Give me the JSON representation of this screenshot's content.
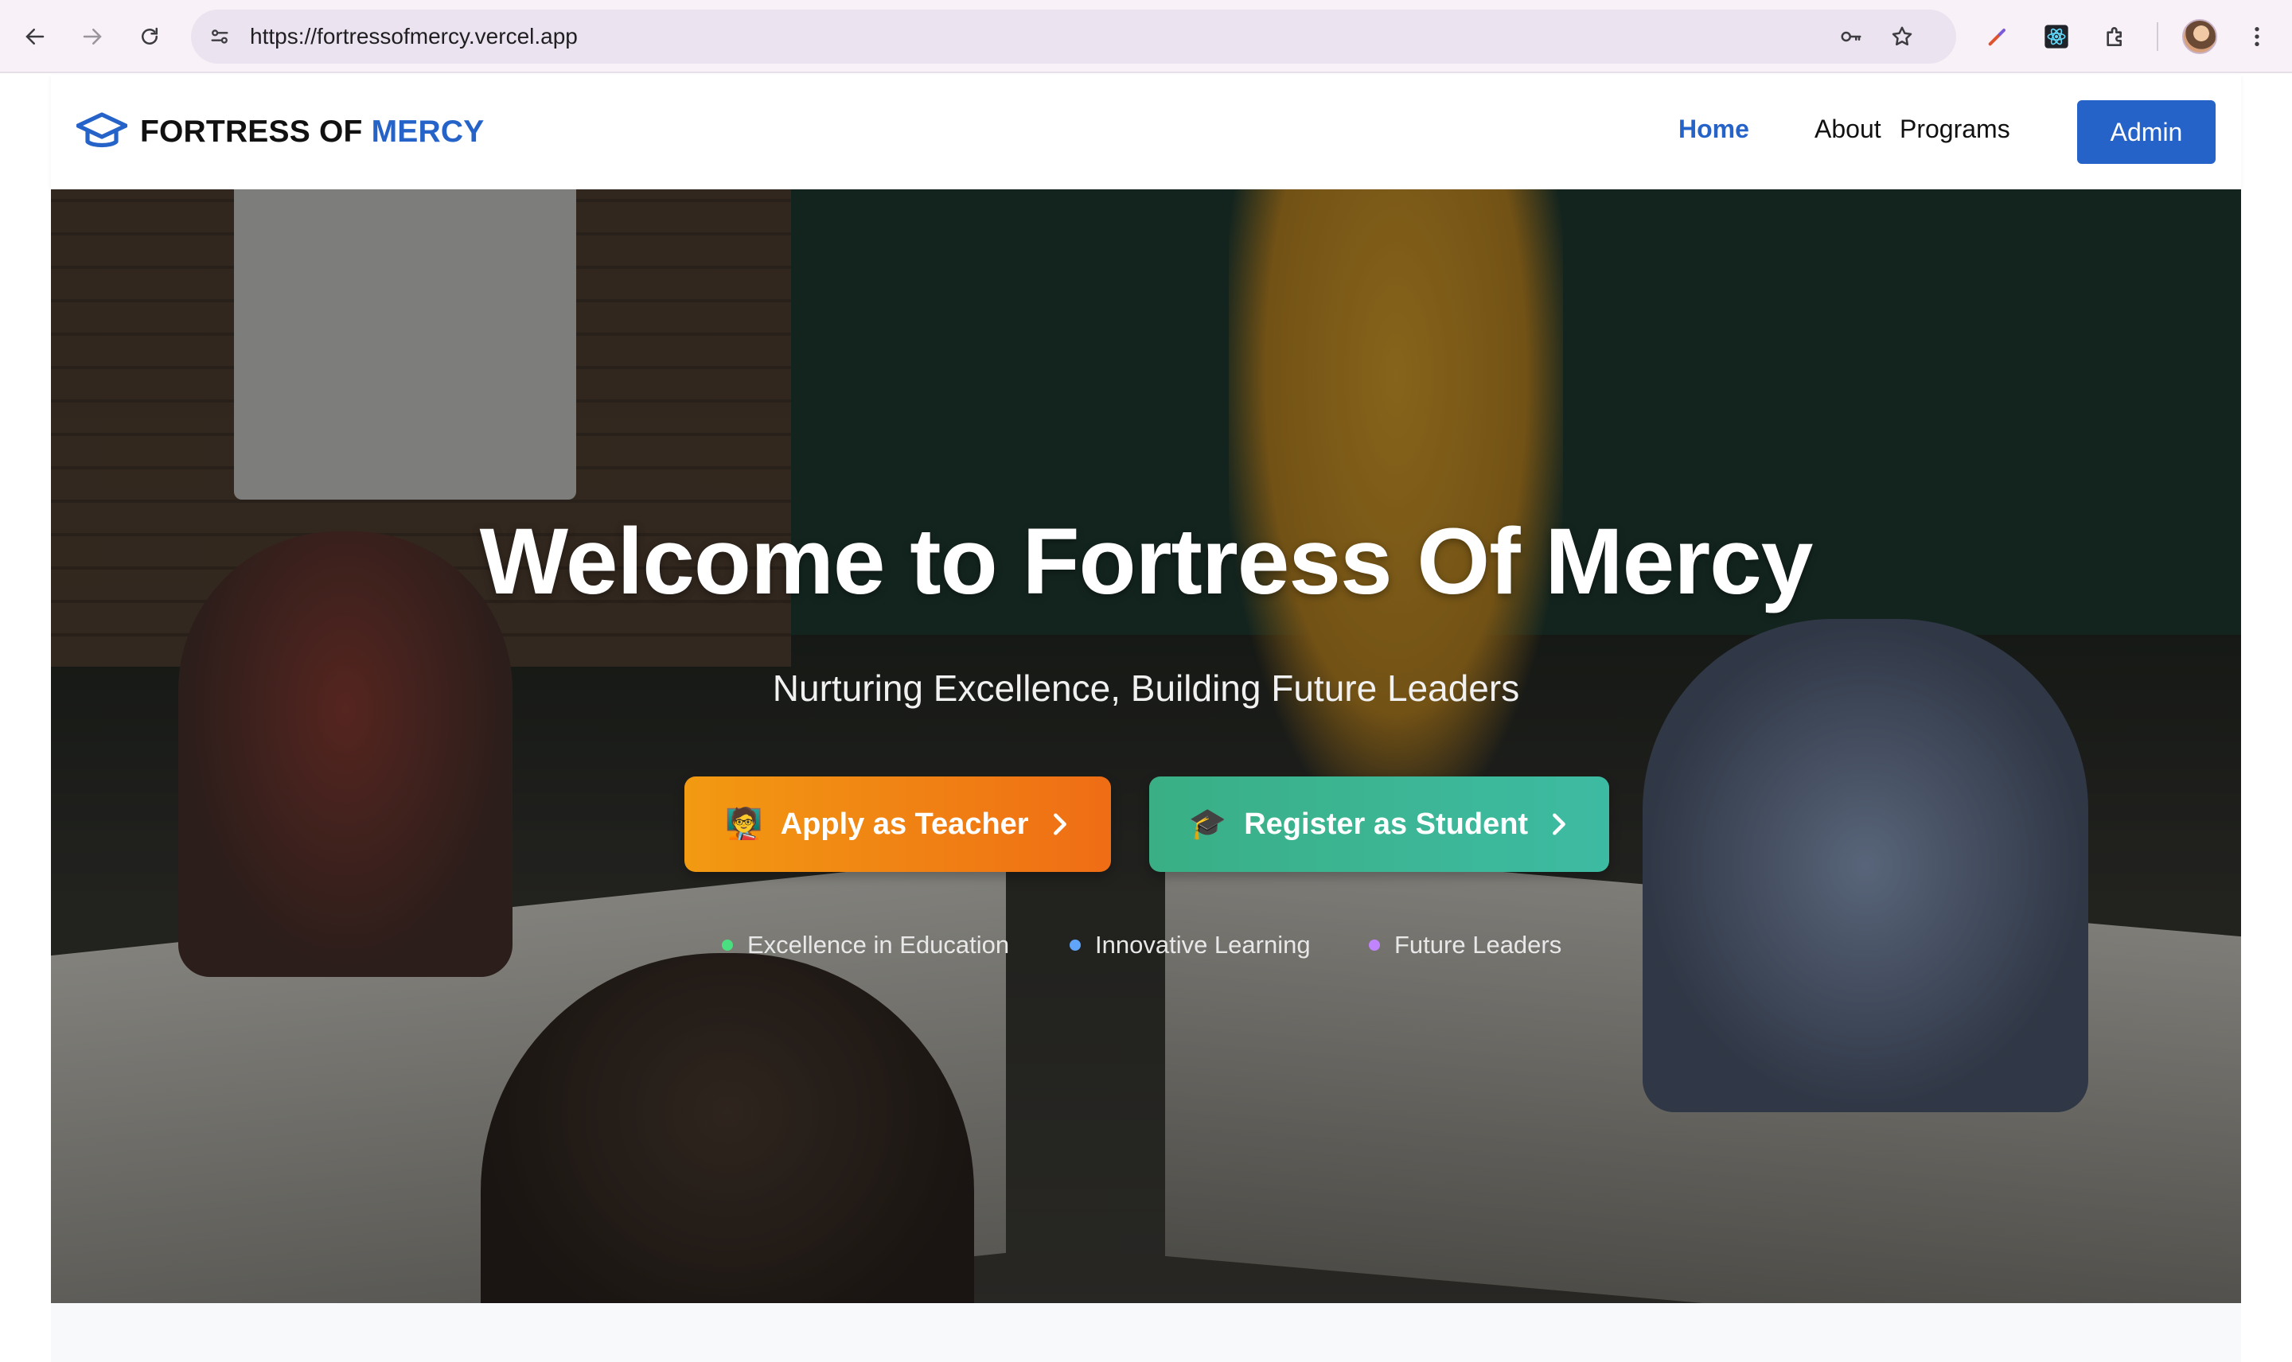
{
  "browser": {
    "url": "https://fortressofmercy.vercel.app",
    "icons": [
      "back-icon",
      "forward-icon",
      "reload-icon",
      "site-info-icon",
      "key-icon",
      "star-icon",
      "color-picker-extension-icon",
      "react-devtools-icon",
      "extensions-icon",
      "profile-avatar",
      "more-icon"
    ]
  },
  "site": {
    "brand_prefix": "FORTRESS OF",
    "brand_accent": "MERCY",
    "logo_icon": "graduation-cap-icon",
    "nav": {
      "home": "Home",
      "about": "About",
      "programs": "Programs",
      "admin": "Admin"
    }
  },
  "hero": {
    "title": "Welcome to Fortress Of Mercy",
    "subtitle": "Nurturing Excellence, Building Future Leaders",
    "cta_teacher": {
      "emoji": "🧑‍🏫",
      "label": "Apply as Teacher"
    },
    "cta_student": {
      "emoji": "🎓",
      "label": "Register as Student"
    },
    "features": [
      {
        "label": "Excellence in Education",
        "color": "#4ade80"
      },
      {
        "label": "Innovative Learning",
        "color": "#60a5fa"
      },
      {
        "label": "Future Leaders",
        "color": "#c084fc"
      }
    ]
  },
  "colors": {
    "primary": "#2563c9",
    "teacher_button": "#f0841a",
    "student_button": "#3bb594"
  }
}
